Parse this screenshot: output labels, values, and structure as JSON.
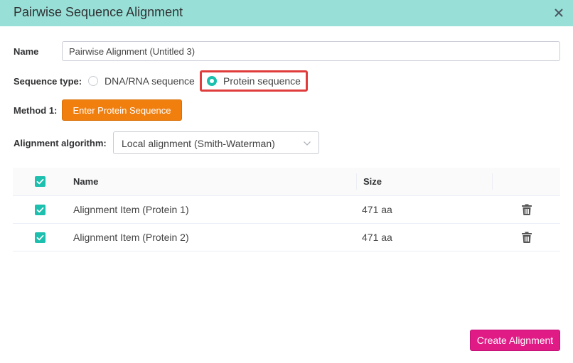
{
  "dialog": {
    "title": "Pairwise Sequence Alignment",
    "close_icon": "close-icon"
  },
  "form": {
    "name_label": "Name",
    "name_value": "Pairwise Alignment (Untitled 3)",
    "sequence_type_label": "Sequence type:",
    "sequence_types": [
      {
        "label": "DNA/RNA sequence",
        "selected": false
      },
      {
        "label": "Protein sequence",
        "selected": true
      }
    ],
    "method_label": "Method 1:",
    "method_button": "Enter Protein Sequence",
    "algorithm_label": "Alignment algorithm:",
    "algorithm_value": "Local alignment (Smith-Waterman)"
  },
  "table": {
    "columns": [
      "Name",
      "Size"
    ],
    "header_checked": true,
    "rows": [
      {
        "name": "Alignment Item (Protein 1)",
        "size": "471 aa",
        "checked": true,
        "action_icon": "trash-icon"
      },
      {
        "name": "Alignment Item (Protein 2)",
        "size": "471 aa",
        "checked": true,
        "action_icon": "trash-icon"
      }
    ]
  },
  "footer": {
    "create_button": "Create Alignment"
  },
  "colors": {
    "header_bg": "#98e0d7",
    "accent_teal": "#1dbfae",
    "method_button": "#f07f0e",
    "create_button": "#e01b86",
    "highlight_border": "#e03c3c"
  }
}
